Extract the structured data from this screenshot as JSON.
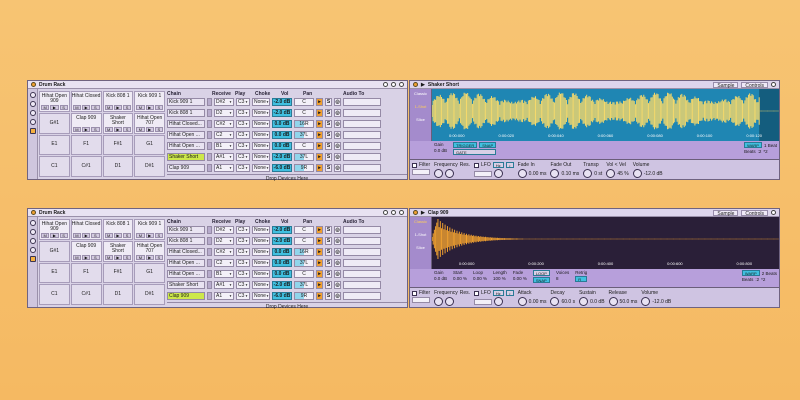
{
  "colors": {
    "background": "#f6bf6c",
    "selected_chain": "#cde84a",
    "volume": "#40c0e0",
    "waveform_1": "#f5d96b",
    "waveform_2": "#f0a030"
  },
  "panels": [
    {
      "rack": {
        "title": "Drum Rack",
        "pads": [
          {
            "label": "Hihat Open 909"
          },
          {
            "label": "Hihat Closed"
          },
          {
            "label": "Kick 808 1"
          },
          {
            "label": "Kick 909 1"
          },
          {
            "label": "G#1"
          },
          {
            "label": "Clap 909"
          },
          {
            "label": "Shaker Short"
          },
          {
            "label": "Hihat Open 707"
          },
          {
            "label": "E1"
          },
          {
            "label": "F1"
          },
          {
            "label": "F#1"
          },
          {
            "label": "G1"
          },
          {
            "label": "C1"
          },
          {
            "label": "C#1"
          },
          {
            "label": "D1"
          },
          {
            "label": "D#1"
          }
        ],
        "pad_controls": [
          "M",
          "▶",
          "S"
        ],
        "headers": {
          "chain": "Chain",
          "receive": "Receive",
          "play": "Play",
          "choke": "Choke",
          "vol": "Vol",
          "pan": "Pan",
          "audio_to": "Audio To"
        },
        "chains": [
          {
            "name": "Kick 909 1",
            "receive": "D#2",
            "play": "C3",
            "choke": "None",
            "vol": "-2.0 dB",
            "pan": "C"
          },
          {
            "name": "Kick 808 1",
            "receive": "D2",
            "play": "C3",
            "choke": "None",
            "vol": "-2.0 dB",
            "pan": "C"
          },
          {
            "name": "Hihat Closed...",
            "receive": "C#2",
            "play": "C3",
            "choke": "None",
            "vol": "0.0 dB",
            "pan": "16R"
          },
          {
            "name": "Hihat Open ...",
            "receive": "C2",
            "play": "C3",
            "choke": "None",
            "vol": "0.0 dB",
            "pan": "37L"
          },
          {
            "name": "Hihat Open ...",
            "receive": "B1",
            "play": "C3",
            "choke": "None",
            "vol": "0.0 dB",
            "pan": "C"
          },
          {
            "name": "Shaker Short",
            "receive": "A#1",
            "play": "C3",
            "choke": "None",
            "vol": "-2.0 dB",
            "pan": "37L"
          },
          {
            "name": "Clap 909",
            "receive": "A1",
            "play": "C3",
            "choke": "None",
            "vol": "-6.0 dB",
            "pan": "9R"
          }
        ],
        "selected_index": 5,
        "drop": "Drop Devices Here"
      },
      "sampler": {
        "title": "Shaker Short",
        "tabs": [
          "Sample",
          "Controls"
        ],
        "side": [
          "Classic",
          "1-Shot",
          "Slice"
        ],
        "side_active": 1,
        "times": [
          "0:00:000",
          "0:00:020",
          "0:00:040",
          "0:00:060",
          "0:00:080",
          "0:00:100",
          "0:00:120"
        ],
        "gain_label": "Gain",
        "gain": "0.0 dB",
        "buttons": [
          "TRIGGER",
          "GATE",
          "SNAP"
        ],
        "warp": "WARP",
        "beats": "Beats",
        "beat_value": "1 Beat",
        "half": ":2",
        "double": "*2",
        "bottom": {
          "filter": "Filter",
          "frequency": "Frequency",
          "res": "Res.",
          "lfo": "LFO",
          "hz": "Hz",
          "sync": "♪",
          "labels": [
            "Fade In",
            "Fade Out",
            "Transp",
            "Vol < Vel",
            "Volume"
          ],
          "values": [
            "0.00 ms",
            "0.10 ms",
            "0 st",
            "45 %",
            "-12.0 dB"
          ]
        }
      }
    },
    {
      "rack": {
        "title": "Drum Rack",
        "pads": [
          {
            "label": "Hihat Open 909"
          },
          {
            "label": "Hihat Closed"
          },
          {
            "label": "Kick 808 1"
          },
          {
            "label": "Kick 909 1"
          },
          {
            "label": "G#1"
          },
          {
            "label": "Clap 909"
          },
          {
            "label": "Shaker Short"
          },
          {
            "label": "Hihat Open 707"
          },
          {
            "label": "E1"
          },
          {
            "label": "F1"
          },
          {
            "label": "F#1"
          },
          {
            "label": "G1"
          },
          {
            "label": "C1"
          },
          {
            "label": "C#1"
          },
          {
            "label": "D1"
          },
          {
            "label": "D#1"
          }
        ],
        "pad_controls": [
          "M",
          "▶",
          "S"
        ],
        "headers": {
          "chain": "Chain",
          "receive": "Receive",
          "play": "Play",
          "choke": "Choke",
          "vol": "Vol",
          "pan": "Pan",
          "audio_to": "Audio To"
        },
        "chains": [
          {
            "name": "Kick 909 1",
            "receive": "D#2",
            "play": "C3",
            "choke": "None",
            "vol": "-2.0 dB",
            "pan": "C"
          },
          {
            "name": "Kick 808 1",
            "receive": "D2",
            "play": "C3",
            "choke": "None",
            "vol": "-2.0 dB",
            "pan": "C"
          },
          {
            "name": "Hihat Closed...",
            "receive": "C#2",
            "play": "C3",
            "choke": "None",
            "vol": "0.0 dB",
            "pan": "16R"
          },
          {
            "name": "Hihat Open ...",
            "receive": "C2",
            "play": "C3",
            "choke": "None",
            "vol": "0.0 dB",
            "pan": "37L"
          },
          {
            "name": "Hihat Open ...",
            "receive": "B1",
            "play": "C3",
            "choke": "None",
            "vol": "0.0 dB",
            "pan": "C"
          },
          {
            "name": "Shaker Short",
            "receive": "A#1",
            "play": "C3",
            "choke": "None",
            "vol": "-2.0 dB",
            "pan": "37L"
          },
          {
            "name": "Clap 909",
            "receive": "A1",
            "play": "C3",
            "choke": "None",
            "vol": "-6.0 dB",
            "pan": "9R"
          }
        ],
        "selected_index": 6,
        "drop": "Drop Devices Here"
      },
      "sampler": {
        "title": "Clap 909",
        "tabs": [
          "Sample",
          "Controls"
        ],
        "side": [
          "Classic",
          "1-Shot",
          "Slice"
        ],
        "side_active": 0,
        "times": [
          "0:00:000",
          "0:00:200",
          "0:00:400",
          "0:00:600",
          "0:00:800"
        ],
        "params": [
          {
            "label": "Gain",
            "value": "0.0 dB"
          },
          {
            "label": "Start",
            "value": "0.00 %"
          },
          {
            "label": "Loop",
            "value": "0.00 %"
          },
          {
            "label": "Length",
            "value": "100 %"
          },
          {
            "label": "Fade",
            "value": "0.00 %"
          }
        ],
        "loop_btn": "LOOP",
        "snap_btn": "SNAP",
        "voices_label": "Voices",
        "voices": "8",
        "retrig_label": "Retrig",
        "retrig": "R",
        "warp": "WARP",
        "beats": "Beats",
        "beat_value": "2 Beats",
        "half": ":2",
        "double": "*2",
        "bottom": {
          "filter": "Filter",
          "frequency": "Frequency",
          "res": "Res.",
          "lfo": "LFO",
          "hz": "Hz",
          "sync": "♪",
          "labels": [
            "Attack",
            "Decay",
            "Sustain",
            "Release",
            "Volume"
          ],
          "values": [
            "0.00 ms",
            "60.0 s",
            "0.0 dB",
            "50.0 ms",
            "-12.0 dB"
          ]
        }
      }
    }
  ]
}
